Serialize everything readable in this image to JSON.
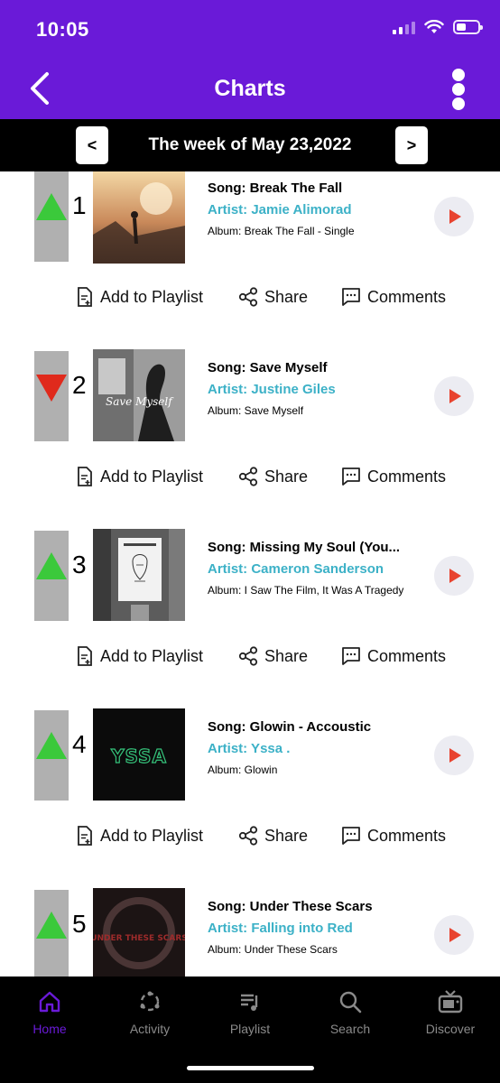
{
  "status": {
    "time": "10:05",
    "battery_level": 0.45
  },
  "header": {
    "title": "Charts",
    "back_icon": "chevron-left-icon",
    "more_icon": "vertical-ellipsis-icon"
  },
  "week": {
    "label": "The week of May 23,2022",
    "prev": "<",
    "next": ">"
  },
  "actions": {
    "add_to_playlist": "Add to Playlist",
    "share": "Share",
    "comments": "Comments"
  },
  "chart": [
    {
      "rank": "1",
      "trend": "up",
      "song": "Song: Break The Fall",
      "artist": "Artist: Jamie Alimorad",
      "album": "Album: Break The Fall - Single"
    },
    {
      "rank": "2",
      "trend": "down",
      "song": "Song: Save Myself",
      "artist": "Artist: Justine Giles",
      "album": "Album: Save Myself",
      "cover_text": "Save Myself"
    },
    {
      "rank": "3",
      "trend": "up",
      "song": "Song: Missing My Soul (You...",
      "artist": "Artist: Cameron Sanderson",
      "album": "Album: I Saw The Film, It Was A Tragedy"
    },
    {
      "rank": "4",
      "trend": "up",
      "song": "Song: Glowin - Accoustic",
      "artist": "Artist: Yssa .",
      "album": "Album: Glowin",
      "cover_text": "YSSA"
    },
    {
      "rank": "5",
      "trend": "up",
      "song": "Song: Under These Scars",
      "artist": "Artist: Falling into Red",
      "album": "Album: Under These Scars",
      "cover_text": "UNDER THESE SCARS"
    }
  ],
  "tabs": [
    {
      "label": "Home",
      "icon": "home-icon",
      "active": true
    },
    {
      "label": "Activity",
      "icon": "activity-icon"
    },
    {
      "label": "Playlist",
      "icon": "playlist-icon"
    },
    {
      "label": "Search",
      "icon": "search-icon"
    },
    {
      "label": "Discover",
      "icon": "tv-icon"
    }
  ],
  "colors": {
    "brand": "#6a1ad8",
    "artist": "#3cb1c7",
    "trend_up": "#3bc93b",
    "trend_down": "#e02a1c",
    "play": "#e8432f"
  }
}
